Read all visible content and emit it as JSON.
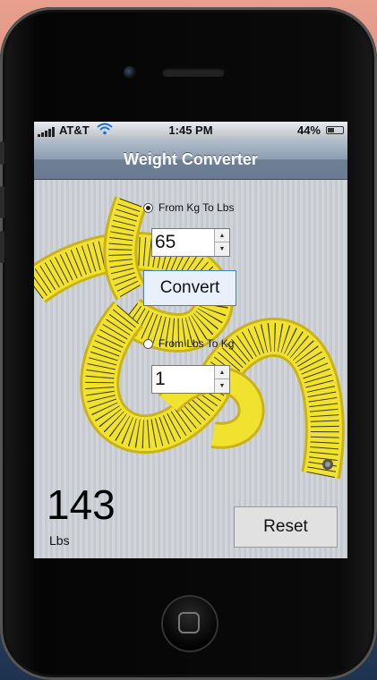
{
  "status_bar": {
    "carrier": "AT&T",
    "time": "1:45 PM",
    "battery_percent": "44%",
    "battery_level": 0.44,
    "wifi_icon": "wifi-icon"
  },
  "app": {
    "title": "Weight Converter"
  },
  "converter": {
    "kg_to_lbs_label": "From Kg To Lbs",
    "kg_to_lbs_selected": true,
    "kg_value": "65",
    "convert_label": "Convert",
    "lbs_to_kg_label": "From Lbs To Kg",
    "lbs_to_kg_selected": false,
    "lbs_value": "1",
    "stepper_up_glyph": "▲",
    "stepper_down_glyph": "▼"
  },
  "result": {
    "value": "143",
    "unit": "Lbs"
  },
  "reset_label": "Reset",
  "colors": {
    "title_bar": "#7d8ca2",
    "tape": "#f2e230",
    "convert_border": "#3b7fc6"
  }
}
